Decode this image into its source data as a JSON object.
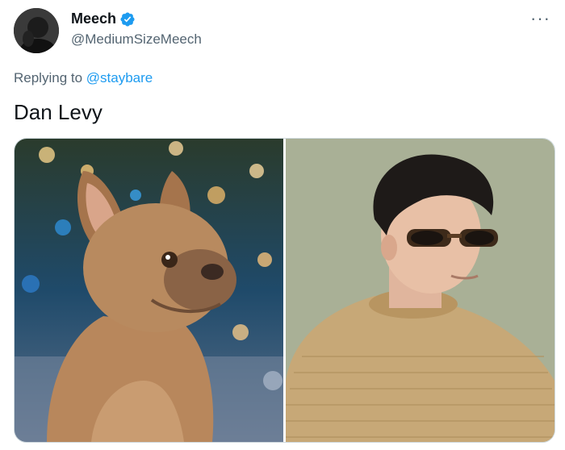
{
  "tweet": {
    "author": {
      "display_name": "Meech",
      "handle": "@MediumSizeMeech",
      "verified": true
    },
    "replying_to": {
      "prefix": "Replying to",
      "mention": "@staybare"
    },
    "text": "Dan Levy",
    "more_icon": "more-horizontal-icon",
    "media": [
      {
        "name": "french-bulldog-photo"
      },
      {
        "name": "dan-levy-photo"
      }
    ]
  },
  "colors": {
    "text_primary": "#0f1419",
    "text_secondary": "#536471",
    "link": "#1d9bf0",
    "verified_badge": "#1d9bf0",
    "media_border": "#cfd9de"
  }
}
